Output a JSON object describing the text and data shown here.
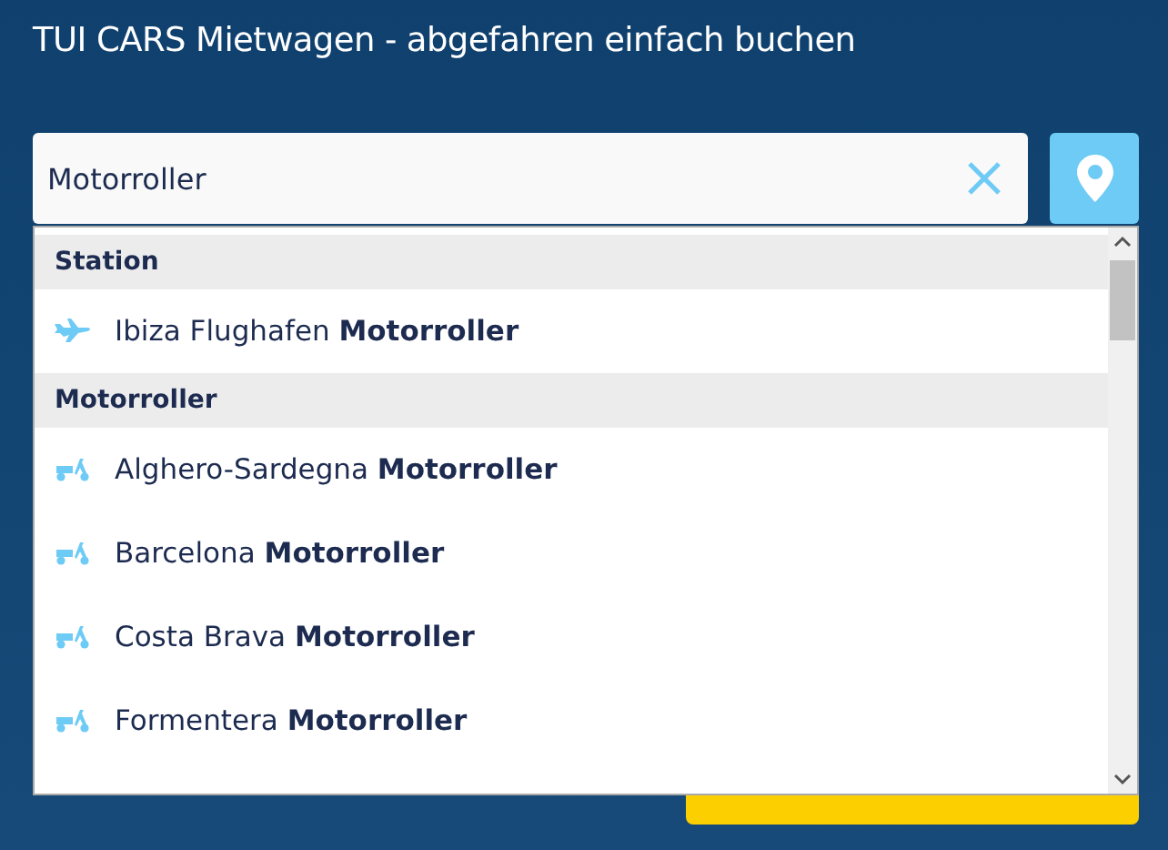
{
  "title": "TUI CARS Mietwagen - abgefahren einfach buchen",
  "search": {
    "value": "Motorroller"
  },
  "results": [
    {
      "kind": "header",
      "label": "Station"
    },
    {
      "kind": "airport",
      "label": "Ibiza Flughafen **Motorroller**"
    },
    {
      "kind": "header",
      "label": "Motorroller"
    },
    {
      "kind": "scooter",
      "label": "Alghero-Sardegna **Motorroller**"
    },
    {
      "kind": "scooter",
      "label": "Barcelona **Motorroller**"
    },
    {
      "kind": "scooter",
      "label": "Costa Brava **Motorroller**"
    },
    {
      "kind": "scooter",
      "label": "Formentera **Motorroller**"
    }
  ]
}
